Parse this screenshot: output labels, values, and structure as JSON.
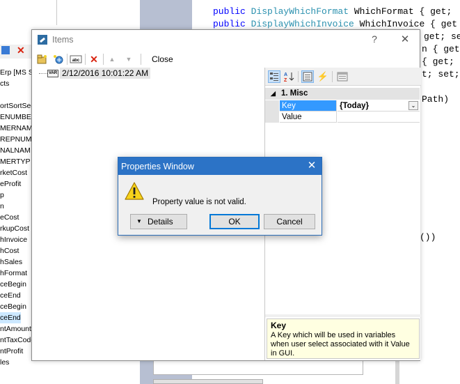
{
  "background": {
    "tree_items": [
      "Erp [MS S",
      "cts",
      "",
      "ortSortSeq",
      "ENUMBE",
      "MERNAM",
      "REPNUM",
      "NALNAM",
      "MERTYP",
      "rketCost",
      "eProfit",
      "p",
      "n",
      "eCost",
      "rkupCost",
      "hInvoice",
      "hCost",
      "hSales",
      "hFormat",
      "ceBegin",
      "ceEnd",
      "ceBegin",
      "ceEnd",
      "ntAmounts",
      "ntTaxCode",
      "ntProfit",
      "les"
    ],
    "selected_tree_item": "ceEnd",
    "code_lines": [
      {
        "kw": "public ",
        "ty": "DisplayWhichFormat",
        "rest": " WhichFormat { get;"
      },
      {
        "kw": "public ",
        "ty": "DisplayWhichInvoice",
        "rest": " WhichInvoice { get"
      },
      {
        "kw": "",
        "ty": "",
        "rest": "get; se"
      },
      {
        "kw": "",
        "ty": "",
        "rest": "n { get;"
      },
      {
        "kw": "",
        "ty": "",
        "rest": "{ get; s"
      },
      {
        "kw": "",
        "ty": "",
        "rest": "t; set;"
      },
      {
        "kw": "",
        "ty": "",
        "rest": "Path)"
      },
      {
        "kw": "",
        "ty": "",
        "rest": "())"
      }
    ]
  },
  "items_window": {
    "title": "Items",
    "help_label": "?",
    "close_glyph": "✕",
    "toolbar": {
      "close_label": "Close"
    },
    "tree": {
      "icon_text": "VAR",
      "node_label": "2/12/2016 10:01:22 AM"
    },
    "property_grid": {
      "category_toggle": "◢",
      "category": "1. Misc",
      "rows": [
        {
          "name": "Key",
          "value": "{Today}"
        },
        {
          "name": "Value",
          "value": ""
        }
      ],
      "dropdown_glyph": "⌄",
      "help_title": "Key",
      "help_text": "A Key which will be used in variables when user select associated with it Value in GUI."
    }
  },
  "dialog": {
    "title": "Properties Window",
    "close_glyph": "✕",
    "message": "Property value is not valid.",
    "details_arrow": "▼",
    "details_label": "Details",
    "ok_label": "OK",
    "cancel_label": "Cancel"
  }
}
